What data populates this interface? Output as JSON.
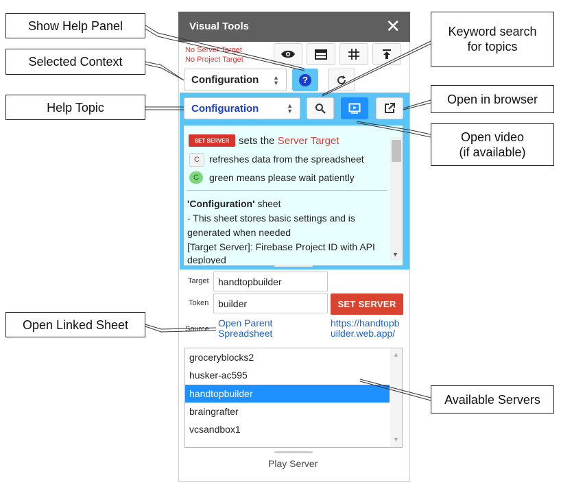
{
  "panel": {
    "title": "Visual Tools",
    "close_glyph": "✕",
    "server_status": "No Server Target",
    "project_status": "No Project Target",
    "toolbar_icons": [
      "eye-icon",
      "window-icon",
      "grid-icon",
      "upload-icon"
    ],
    "context_select": "Configuration",
    "help_button_glyph": "?",
    "refresh_glyph": "C",
    "topic_select": "Configuration",
    "help": {
      "set_server_chip": "SET SERVER",
      "line1_pre": "sets the",
      "line1_target": "Server Target",
      "line2": "refreshes data from the spreadsheet",
      "line3": "green means please wait patiently",
      "sheet_name": "'Configuration'",
      "sheet_word": "sheet",
      "body_lines": [
        "- This sheet stores basic settings and is",
        "generated when needed",
        "[Target Server]: Firebase Project ID with API",
        "deployed"
      ]
    },
    "form": {
      "target_label": "Target",
      "target_value": "handtopbuilder",
      "token_label": "Token",
      "token_value": "builder",
      "set_server_button": "SET SERVER",
      "source_label": "Source",
      "open_parent_line1": "Open Parent",
      "open_parent_line2": "Spreadsheet",
      "url_line1": "https://handtopb",
      "url_line2": "uilder.web.app/"
    },
    "servers": [
      "groceryblocks2",
      "husker-ac595",
      "handtopbuilder",
      "braingrafter",
      "vcsandbox1"
    ],
    "selected_server": "handtopbuilder",
    "play_server": "Play Server"
  },
  "callouts": {
    "show_help": "Show Help Panel",
    "selected_context": "Selected Context",
    "help_topic": "Help Topic",
    "open_linked_sheet": "Open Linked Sheet",
    "keyword_line1": "Keyword search",
    "keyword_line2": "for topics",
    "open_browser": "Open in browser",
    "open_video_line1": "Open video",
    "open_video_line2": "(if available)",
    "available_servers": "Available Servers"
  },
  "colors": {
    "titlebar": "#5f5f5f",
    "help_blue": "#5cc3f5",
    "help_bg": "#e8ffff",
    "accent_red": "#d9432f",
    "selection_blue": "#1e90ff",
    "link_blue": "#1a64c8"
  }
}
